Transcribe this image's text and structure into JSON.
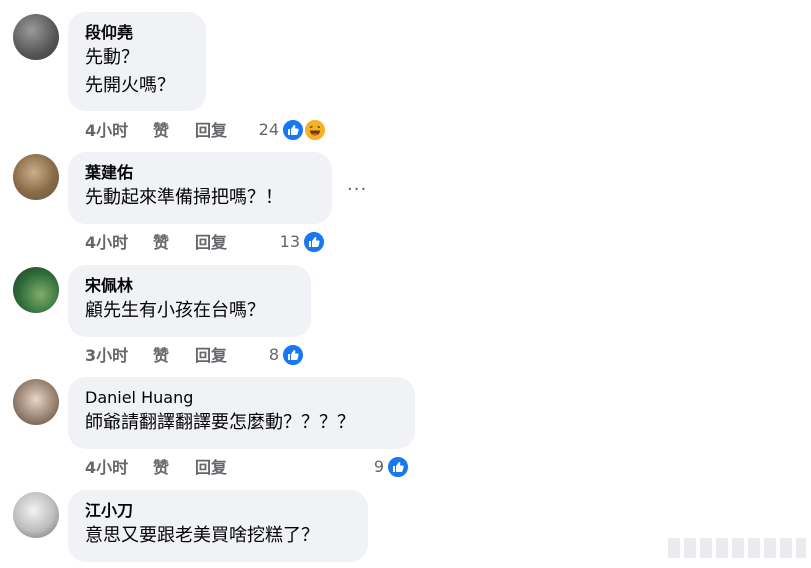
{
  "comments": [
    {
      "author": "段仰堯",
      "lines": [
        "先動？",
        "先開火嗎？"
      ],
      "time": "4小时",
      "like_label": "赞",
      "reply_label": "回复",
      "reaction_count": "24",
      "reactions": [
        "like-icon",
        "haha-icon"
      ]
    },
    {
      "author": "葉建佑",
      "lines": [
        "先動起來準備掃把嗎？！"
      ],
      "time": "4小时",
      "like_label": "赞",
      "reply_label": "回复",
      "reaction_count": "13",
      "reactions": [
        "like-icon"
      ],
      "more_label": "···"
    },
    {
      "author": "宋佩林",
      "lines": [
        "顧先生有小孩在台嗎？"
      ],
      "time": "3小时",
      "like_label": "赞",
      "reply_label": "回复",
      "reaction_count": "8",
      "reactions": [
        "like-icon"
      ]
    },
    {
      "author": "Daniel Huang",
      "lines": [
        "師爺請翻譯翻譯要怎麼動？？？？"
      ],
      "time": "4小时",
      "like_label": "赞",
      "reply_label": "回复",
      "reaction_count": "9",
      "reactions": [
        "like-icon"
      ]
    },
    {
      "author": "江小刀",
      "lines": [
        "意思又要跟老美買啥挖糕了？"
      ],
      "time": "",
      "like_label": "",
      "reply_label": "",
      "reaction_count": "",
      "reactions": []
    }
  ],
  "colors": {
    "bubble": "#f0f2f5",
    "meta_text": "#65676b",
    "like_blue": "#1877f2",
    "haha_yellow": "#f7b125"
  }
}
